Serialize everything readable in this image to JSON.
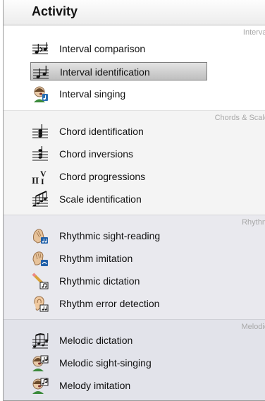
{
  "panel": {
    "title": "Activity"
  },
  "groups": [
    {
      "label": "Interval",
      "items": [
        {
          "label": "Interval comparison",
          "icon": "interval-comparison-icon"
        },
        {
          "label": "Interval identification",
          "icon": "interval-identification-icon",
          "selected": true
        },
        {
          "label": "Interval singing",
          "icon": "singer-icon"
        }
      ]
    },
    {
      "label": "Chords & Scale",
      "items": [
        {
          "label": "Chord identification",
          "icon": "chord-icon"
        },
        {
          "label": "Chord inversions",
          "icon": "chord-inversion-icon"
        },
        {
          "label": "Chord progressions",
          "icon": "chord-progression-icon"
        },
        {
          "label": "Scale identification",
          "icon": "scale-icon"
        }
      ]
    },
    {
      "label": "Rhythm",
      "items": [
        {
          "label": "Rhythmic sight-reading",
          "icon": "clapping-hands-icon"
        },
        {
          "label": "Rhythm imitation",
          "icon": "hand-tapping-icon"
        },
        {
          "label": "Rhythmic dictation",
          "icon": "pencil-note-icon"
        },
        {
          "label": "Rhythm error detection",
          "icon": "ear-icon"
        }
      ]
    },
    {
      "label": "Melodie",
      "items": [
        {
          "label": "Melodic dictation",
          "icon": "melody-notes-icon"
        },
        {
          "label": "Melodic sight-singing",
          "icon": "singer-note-icon"
        },
        {
          "label": "Melody imitation",
          "icon": "singer-imitation-icon"
        }
      ]
    }
  ]
}
